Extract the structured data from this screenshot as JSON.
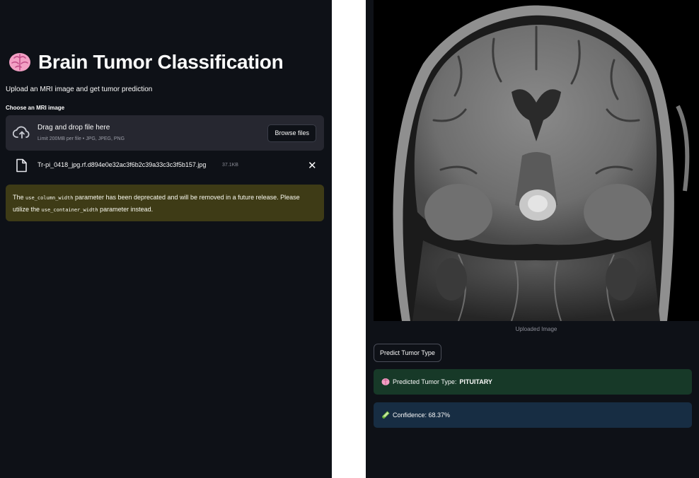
{
  "app": {
    "title": "Brain Tumor Classification",
    "subtitle": "Upload an MRI image and get tumor prediction",
    "title_icon": "brain-emoji-icon"
  },
  "uploader": {
    "label": "Choose an MRI image",
    "dropzone_title": "Drag and drop file here",
    "dropzone_hint": "Limit 200MB per file • JPG, JPEG, PNG",
    "browse_label": "Browse files",
    "file": {
      "name": "Tr-pi_0418_jpg.rf.d894e0e32ac3f6b2c39a33c3c3f5b157.jpg",
      "size": "37.1KB"
    }
  },
  "warning": {
    "pre": "The ",
    "code1": "use_column_width",
    "mid": " parameter has been deprecated and will be removed in a future release. Please utilize the ",
    "code2": "use_container_width",
    "post": " parameter instead."
  },
  "image": {
    "caption": "Uploaded Image"
  },
  "predict_button": "Predict Tumor Type",
  "result": {
    "prefix": "Predicted Tumor Type: ",
    "value": "PITUITARY",
    "confidence": "Confidence: 68.37%"
  },
  "colors": {
    "background": "#0e1117",
    "dropzone": "#262730",
    "warning_bg": "#3e3b16",
    "success_bg": "#173928",
    "info_bg": "#172d43"
  }
}
